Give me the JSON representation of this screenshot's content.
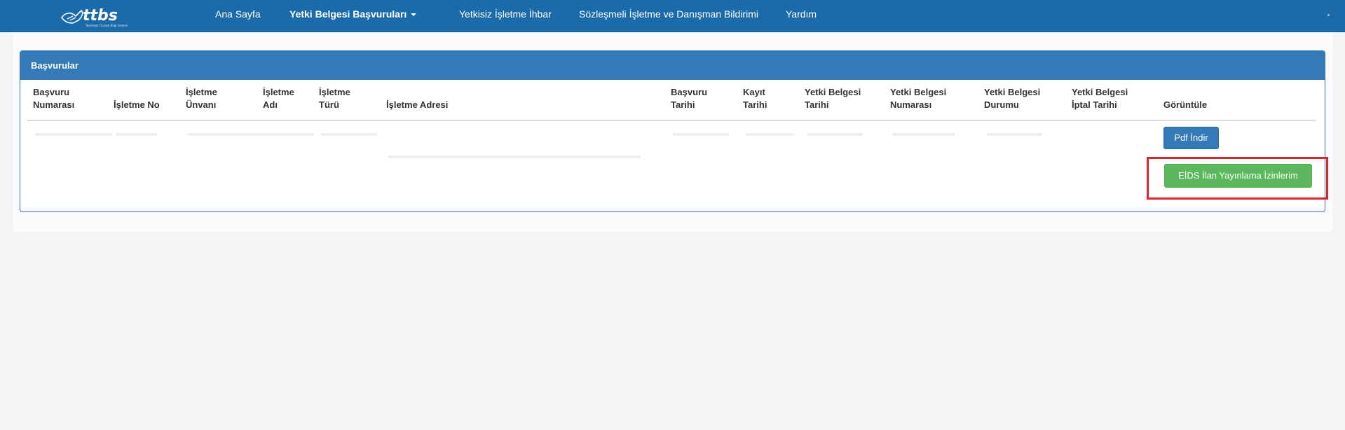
{
  "brand": {
    "logo_text": "ttbs",
    "logo_subtitle": "Tasinmaz Ticareti Bilgi Sistemi"
  },
  "navbar": {
    "items": [
      {
        "label": "Ana Sayfa"
      },
      {
        "label": "Yetki Belgesi Başvuruları"
      },
      {
        "label": "Yetkisiz İşletme İhbar"
      },
      {
        "label": "Sözleşmeli İşletme ve Danışman Bildirimi"
      },
      {
        "label": "Yardım"
      }
    ],
    "active_index": 1,
    "dropdown_icon": "caret-down-icon"
  },
  "panel": {
    "title": "Başvurular",
    "columns": [
      {
        "line1": "Başvuru",
        "line2": "Numarası"
      },
      {
        "line1": "",
        "line2": "İşletme No"
      },
      {
        "line1": "İşletme",
        "line2": "Ünvanı"
      },
      {
        "line1": "İşletme",
        "line2": "Adı"
      },
      {
        "line1": "İşletme",
        "line2": "Türü"
      },
      {
        "line1": "",
        "line2": "İşletme Adresi"
      },
      {
        "line1": "Başvuru",
        "line2": "Tarihi"
      },
      {
        "line1": "Kayıt",
        "line2": "Tarihi"
      },
      {
        "line1": "Yetki Belgesi",
        "line2": "Tarihi"
      },
      {
        "line1": "Yetki Belgesi",
        "line2": "Numarası"
      },
      {
        "line1": "Yetki Belgesi",
        "line2": "Durumu"
      },
      {
        "line1": "Yetki Belgesi",
        "line2": "İptal Tarihi"
      },
      {
        "line1": "",
        "line2": "Görüntüle"
      }
    ],
    "row_actions": {
      "pdf_label": "Pdf İndir",
      "eids_label": "EİDS İlan Yayınlama İzinlerim"
    }
  },
  "colors": {
    "navbar": "#1b6bab",
    "panel_heading": "#337ab7",
    "primary_button": "#337ab7",
    "success_button": "#5cb85c",
    "highlight": "#d9262c"
  }
}
